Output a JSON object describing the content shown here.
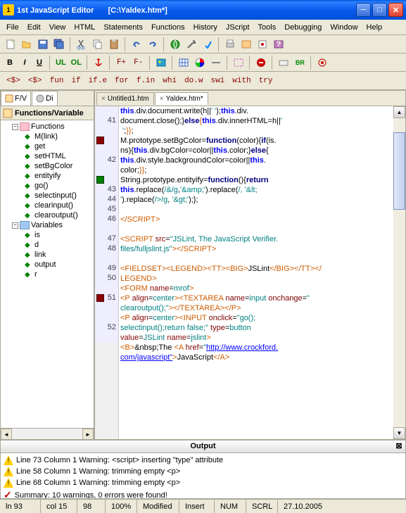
{
  "window": {
    "app_name": "1st JavaScript Editor",
    "file_path": "[C:\\Yaldex.htm*]"
  },
  "menu": [
    "File",
    "Edit",
    "View",
    "HTML",
    "Statements",
    "Functions",
    "History",
    "JScript",
    "Tools",
    "Debugging",
    "Window",
    "Help"
  ],
  "toolbar2": {
    "bold": "B",
    "italic": "I",
    "underline": "U",
    "ul": "UL",
    "ol": "OL",
    "fp": "F+",
    "fm": "F-"
  },
  "toolbar3": [
    "<$>",
    "<$>",
    "fun",
    "if",
    "if.e",
    "for",
    "f.in",
    "whi",
    "do.w",
    "swi",
    "with",
    "try"
  ],
  "left_tabs": [
    "F/V",
    "Di"
  ],
  "tree_header": "Functions/Variable",
  "tree": {
    "functions_label": "Functions",
    "functions": [
      "M(link)",
      "get",
      "setHTML",
      "setBgColor",
      "entityify",
      "go()",
      "selectinput()",
      "clearinput()",
      "clearoutput()"
    ],
    "variables_label": "Variables",
    "variables": [
      "is",
      "d",
      "link",
      "output",
      "r"
    ]
  },
  "tabs": [
    {
      "label": "Untitled1.htm",
      "active": false
    },
    {
      "label": "Yaldex.htm*",
      "active": true
    }
  ],
  "gutter_lines": [
    "",
    "41",
    "",
    "",
    "",
    "42",
    "",
    "",
    "43",
    "44",
    "45",
    "46",
    "",
    "47",
    "48",
    "",
    "49",
    "50",
    "",
    "51",
    "",
    "",
    "52",
    ""
  ],
  "code_lines": [
    {
      "html": "<span class='kw'>this</span>.div.document.write(h||<span class='str'>' '</span>);<span class='kw'>this</span>.div."
    },
    {
      "html": "document.close();}<span class='kw2'>else</span><span class='pn'>{</span><span class='kw'>this</span>.div.innerHTML=h||<span class='str'>'"
    },
    {
      "html": "<span class='str'> '</span>;<span class='pn'>}}</span>;"
    },
    {
      "html": "M.prototype.setBgColor=<span class='kw2'>function</span>(color){<span class='kw2'>if</span>(is."
    },
    {
      "html": "ns){<span class='kw'>this</span>.div.bgColor=color||<span class='kw'>this</span>.color;}<span class='kw2'>else</span>{"
    },
    {
      "html": "<span class='kw'>this</span>.div.style.backgroundColor=color||<span class='kw'>this</span>."
    },
    {
      "html": "color;<span class='pn'>}}</span>;"
    },
    {
      "html": "String.prototype.entityify=<span class='kw2'>function</span>(){<span class='kw2'>return</span>"
    },
    {
      "html": "<span class='kw'>this</span>.replace(<span class='str'>/&/g</span>,<span class='str'>'&amp;amp;'</span>).replace(<span class='str'>/</g</span>, <span class='str'>'&amp;lt;"
    },
    {
      "html": "<span class='str'>'</span>).replace(<span class='str'>/>/g</span>, <span class='str'>'&amp;gt;'</span>);};"
    },
    {
      "html": ""
    },
    {
      "html": "<span class='tag'>&lt;/SCRIPT&gt;</span>"
    },
    {
      "html": ""
    },
    {
      "html": "<span class='tag'>&lt;SCRIPT</span> <span class='attr'>src</span>=<span class='av'>\"JSLint, The JavaScript Verifier.</span>"
    },
    {
      "html": "<span class='av'>files/fulljslint.js\"</span><span class='tag'>&gt;&lt;/SCRIPT&gt;</span>"
    },
    {
      "html": ""
    },
    {
      "html": "<span class='tag'>&lt;FIELDSET&gt;&lt;LEGEND&gt;&lt;TT&gt;&lt;BIG&gt;</span>JSLint<span class='tag'>&lt;/BIG&gt;&lt;/TT&gt;&lt;/</span>"
    },
    {
      "html": "<span class='tag'>LEGEND&gt;</span>"
    },
    {
      "html": "<span class='tag'>&lt;FORM</span> <span class='attr'>name</span>=<span class='av'>mrof</span><span class='tag'>&gt;</span>"
    },
    {
      "html": "<span class='tag'>&lt;P</span> <span class='attr'>align</span>=<span class='av'>center</span><span class='tag'>&gt;&lt;TEXTAREA</span> <span class='attr'>name</span>=<span class='av'>input</span> <span class='attr'>onchange</span>=<span class='av'>\"</span>"
    },
    {
      "html": "<span class='av'>clearoutput();\"</span><span class='tag'>&gt;&lt;/TEXTAREA&gt;&lt;/P&gt;</span>"
    },
    {
      "html": "<span class='tag'>&lt;P</span> <span class='attr'>align</span>=<span class='av'>center</span><span class='tag'>&gt;&lt;INPUT</span> <span class='attr'>onclick</span>=<span class='av'>\"go();</span>"
    },
    {
      "html": "<span class='av'>selectinput();return false;\"</span> <span class='attr'>type</span>=<span class='av'>button</span>"
    },
    {
      "html": "<span class='attr'>value</span>=<span class='av'>JSLint</span> <span class='attr'>name</span>=<span class='av'>jslint</span><span class='tag'>&gt;</span>"
    },
    {
      "html": "<span class='tag'>&lt;B&gt;</span>&amp;nbsp;The <span class='tag'>&lt;A</span> <span class='attr'>href</span>=<span class='av'>\"</span><span class='url'>http://www.crockford.</span>"
    },
    {
      "html": "<span class='url'>com/javascript\"</span><span class='tag'>&gt;</span>JavaScript<span class='tag'>&lt;/A&gt;</span>"
    }
  ],
  "output": {
    "title": "Output",
    "lines": [
      {
        "type": "warn",
        "text": "Line 73 Column 1  Warning: <script> inserting \"type\" attribute"
      },
      {
        "type": "warn",
        "text": "Line 58 Column 1  Warning: trimming empty <p>"
      },
      {
        "type": "warn",
        "text": "Line 68 Column 1  Warning: trimming empty <p>"
      },
      {
        "type": "ok",
        "text": "Summary: 10 warnings, 0 errors were found!"
      }
    ]
  },
  "status": {
    "ln": "ln 93",
    "col": "col 15",
    "num1": "98",
    "num2": "100%",
    "mod": "Modified",
    "ins": "Insert",
    "num": "NUM",
    "scrl": "SCRL",
    "date": "27.10.2005"
  }
}
